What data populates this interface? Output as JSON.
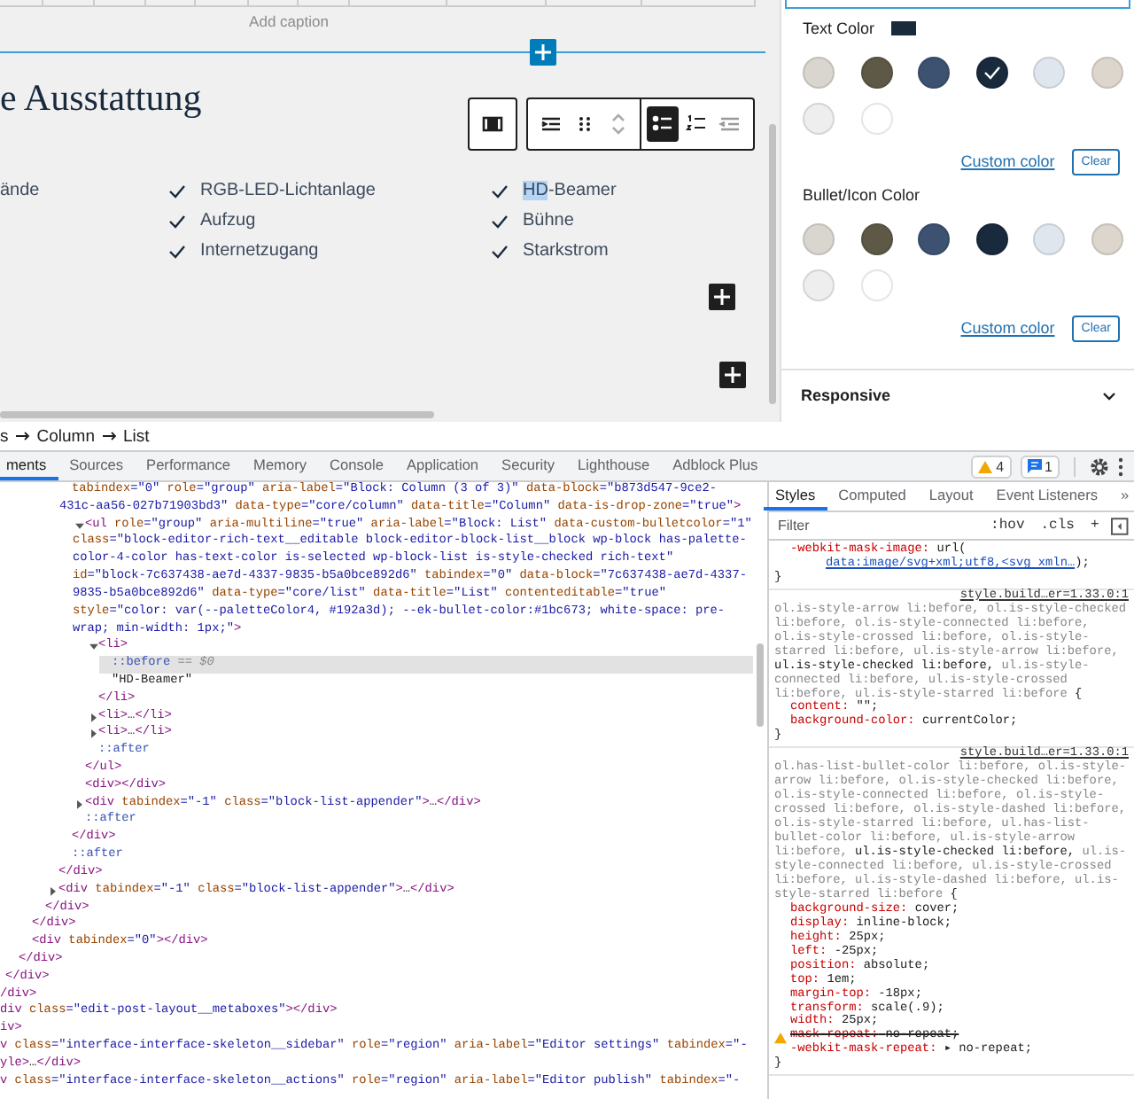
{
  "editor": {
    "caption_placeholder": "Add caption",
    "heading": "e Ausstattung",
    "toolbar": [
      {
        "buttons": [
          {
            "kind": "columns",
            "selected": false
          }
        ]
      },
      {
        "buttons": [
          {
            "kind": "indent",
            "selected": false
          },
          {
            "kind": "drag",
            "selected": false
          },
          {
            "kind": "move",
            "selected": false
          },
          {
            "kind": "bullets",
            "selected": true
          },
          {
            "kind": "numbers",
            "selected": false
          },
          {
            "kind": "outdent",
            "selected": false
          }
        ]
      }
    ],
    "list_columns": [
      {
        "items": [
          {
            "kind": "plain",
            "parts": [
              {
                "text": "ände",
                "selected": false
              }
            ]
          }
        ]
      },
      {
        "items": [
          {
            "kind": "checked",
            "parts": [
              {
                "text": "RGB-LED-Lichtanlage",
                "selected": false
              }
            ]
          },
          {
            "kind": "checked",
            "parts": [
              {
                "text": "Aufzug",
                "selected": false
              }
            ]
          },
          {
            "kind": "checked",
            "parts": [
              {
                "text": "Internetzugang",
                "selected": false
              }
            ]
          }
        ]
      },
      {
        "items": [
          {
            "kind": "checked",
            "parts": [
              {
                "text": "HD",
                "selected": true
              },
              {
                "text": "-Beamer",
                "selected": false
              }
            ]
          },
          {
            "kind": "checked",
            "parts": [
              {
                "text": "Bühne",
                "selected": false
              }
            ]
          },
          {
            "kind": "checked",
            "parts": [
              {
                "text": "Starkstrom",
                "selected": false
              }
            ]
          }
        ]
      }
    ]
  },
  "sidebar": {
    "sections": [
      {
        "title": "Text Color",
        "current_swatch": {
          "color": "#192a3d"
        },
        "swatches": [
          {
            "color": "#d9d5cf",
            "selected": false
          },
          {
            "color": "#5e5846",
            "selected": false
          },
          {
            "color": "#3d5170",
            "selected": false
          },
          {
            "color": "#192a3d",
            "selected": true
          },
          {
            "color": "#dfe6ed",
            "selected": false
          },
          {
            "color": "#dcd6cc",
            "selected": false
          },
          {
            "color": "#eeeeee",
            "selected": false
          },
          {
            "color": "#ffffff",
            "selected": false
          }
        ],
        "custom_link": "Custom color",
        "clear_button": "Clear"
      },
      {
        "title": "Bullet/Icon Color",
        "swatches": [
          {
            "color": "#d9d5cf",
            "selected": false
          },
          {
            "color": "#5e5846",
            "selected": false
          },
          {
            "color": "#3d5170",
            "selected": false
          },
          {
            "color": "#192a3d",
            "selected": false
          },
          {
            "color": "#dfe6ed",
            "selected": false
          },
          {
            "color": "#dcd6cc",
            "selected": false
          },
          {
            "color": "#eeeeee",
            "selected": false
          },
          {
            "color": "#ffffff",
            "selected": false
          }
        ],
        "custom_link": "Custom color",
        "clear_button": "Clear"
      }
    ],
    "panel": {
      "title": "Responsive",
      "expanded": false
    }
  },
  "breadcrumb": [
    "s",
    "Column",
    "List"
  ],
  "devtools": {
    "tabs": [
      {
        "label": "ments",
        "selected": true
      },
      {
        "label": "Sources",
        "selected": false
      },
      {
        "label": "Performance",
        "selected": false
      },
      {
        "label": "Memory",
        "selected": false
      },
      {
        "label": "Console",
        "selected": false
      },
      {
        "label": "Application",
        "selected": false
      },
      {
        "label": "Security",
        "selected": false
      },
      {
        "label": "Lighthouse",
        "selected": false
      },
      {
        "label": "Adblock Plus",
        "selected": false
      }
    ],
    "warnings": "4",
    "messages": "1",
    "dom_tree": [
      {
        "children": [
          {
            "children": [
              {
                "children": [
                  {
                    "children": [
                      {
                        "children": [
                          {
                            "children": [
                              {
                                "selected": false,
                                "segments": [
                                  {
                                    "kind": "attr",
                                    "text": "tabindex"
                                  },
                                  {
                                    "kind": "value",
                                    "text": "=\"0\""
                                  },
                                  {
                                    "kind": "attr",
                                    "text": " role"
                                  },
                                  {
                                    "kind": "value",
                                    "text": "=\"group\""
                                  },
                                  {
                                    "kind": "attr",
                                    "text": " aria-label"
                                  },
                                  {
                                    "kind": "value",
                                    "text": "=\"Block: Column (3 of 3)\""
                                  },
                                  {
                                    "kind": "attr",
                                    "text": " data-block"
                                  },
                                  {
                                    "kind": "value",
                                    "text": "=\"b873d547-9ce2-431c-aa56-027b71903bd3\""
                                  },
                                  {
                                    "kind": "attr",
                                    "text": " data-type"
                                  },
                                  {
                                    "kind": "value",
                                    "text": "=\"core/column\""
                                  },
                                  {
                                    "kind": "attr",
                                    "text": " data-title"
                                  },
                                  {
                                    "kind": "value",
                                    "text": "=\"Column\""
                                  },
                                  {
                                    "kind": "attr",
                                    "text": " data-is-drop-zone"
                                  },
                                  {
                                    "kind": "value",
                                    "text": "=\"true\""
                                  },
                                  {
                                    "kind": "tag",
                                    "text": ">"
                                  }
                                ],
                                "children": [
                                  {
                                    "expanded": true,
                                    "selected": false,
                                    "segments": [
                                      {
                                        "kind": "tag",
                                        "text": "<ul"
                                      },
                                      {
                                        "kind": "attr",
                                        "text": " role"
                                      },
                                      {
                                        "kind": "value",
                                        "text": "=\"group\""
                                      },
                                      {
                                        "kind": "attr",
                                        "text": " aria-multiline"
                                      },
                                      {
                                        "kind": "value",
                                        "text": "=\"true\""
                                      },
                                      {
                                        "kind": "attr",
                                        "text": " aria-label"
                                      },
                                      {
                                        "kind": "value",
                                        "text": "=\"Block: List\""
                                      },
                                      {
                                        "kind": "attr",
                                        "text": " data-custom-bulletcolor"
                                      },
                                      {
                                        "kind": "value",
                                        "text": "=\"1\""
                                      },
                                      {
                                        "kind": "attr",
                                        "text": " class"
                                      },
                                      {
                                        "kind": "value",
                                        "text": "=\"block-editor-rich-text__editable block-editor-block-list__block wp-block has-palette-color-4-color has-text-color is-selected wp-block-list is-style-checked rich-text\""
                                      },
                                      {
                                        "kind": "attr",
                                        "text": " id"
                                      },
                                      {
                                        "kind": "value",
                                        "text": "=\"block-7c637438-ae7d-4337-9835-b5a0bce892d6\""
                                      },
                                      {
                                        "kind": "attr",
                                        "text": " tabindex"
                                      },
                                      {
                                        "kind": "value",
                                        "text": "=\"0\""
                                      },
                                      {
                                        "kind": "attr",
                                        "text": " data-block"
                                      },
                                      {
                                        "kind": "value",
                                        "text": "=\"7c637438-ae7d-4337-9835-b5a0bce892d6\""
                                      },
                                      {
                                        "kind": "attr",
                                        "text": " data-type"
                                      },
                                      {
                                        "kind": "value",
                                        "text": "=\"core/list\""
                                      },
                                      {
                                        "kind": "attr",
                                        "text": " data-title"
                                      },
                                      {
                                        "kind": "value",
                                        "text": "=\"List\""
                                      },
                                      {
                                        "kind": "attr",
                                        "text": " contenteditable"
                                      },
                                      {
                                        "kind": "value",
                                        "text": "=\"true\""
                                      },
                                      {
                                        "kind": "attr",
                                        "text": " style"
                                      },
                                      {
                                        "kind": "value",
                                        "text": "=\"color: var(--paletteColor4, #192a3d); --ek-bullet-color:#1bc673; white-space: pre-wrap; min-width: 1px;\""
                                      },
                                      {
                                        "kind": "tag",
                                        "text": ">"
                                      }
                                    ],
                                    "children": [
                                      {
                                        "expanded": true,
                                        "selected": false,
                                        "segments": [
                                          {
                                            "kind": "tag",
                                            "text": "<li>"
                                          }
                                        ],
                                        "children": [
                                          {
                                            "selected": true,
                                            "segments": [
                                              {
                                                "kind": "pseudo",
                                                "text": "::before"
                                              },
                                              {
                                                "kind": "hint",
                                                "text": " == $0"
                                              }
                                            ]
                                          },
                                          {
                                            "selected": false,
                                            "segments": [
                                              {
                                                "kind": "text",
                                                "text": "\"HD-Beamer\""
                                              }
                                            ]
                                          }
                                        ]
                                      },
                                      {
                                        "selected": false,
                                        "segments": [
                                          {
                                            "kind": "tag",
                                            "text": "</li>"
                                          }
                                        ]
                                      },
                                      {
                                        "expanded": false,
                                        "selected": false,
                                        "segments": [
                                          {
                                            "kind": "tag",
                                            "text": "<li>"
                                          },
                                          {
                                            "kind": "text",
                                            "text": "…"
                                          },
                                          {
                                            "kind": "tag",
                                            "text": "</li>"
                                          }
                                        ]
                                      },
                                      {
                                        "expanded": false,
                                        "selected": false,
                                        "segments": [
                                          {
                                            "kind": "tag",
                                            "text": "<li>"
                                          },
                                          {
                                            "kind": "text",
                                            "text": "…"
                                          },
                                          {
                                            "kind": "tag",
                                            "text": "</li>"
                                          }
                                        ]
                                      },
                                      {
                                        "selected": false,
                                        "segments": [
                                          {
                                            "kind": "pseudo",
                                            "text": "::after"
                                          }
                                        ]
                                      }
                                    ]
                                  },
                                  {
                                    "selected": false,
                                    "segments": [
                                      {
                                        "kind": "tag",
                                        "text": "</ul>"
                                      }
                                    ]
                                  },
                                  {
                                    "selected": false,
                                    "segments": [
                                      {
                                        "kind": "tag",
                                        "text": "<div></div>"
                                      }
                                    ]
                                  },
                                  {
                                    "expanded": false,
                                    "selected": false,
                                    "segments": [
                                      {
                                        "kind": "tag",
                                        "text": "<div"
                                      },
                                      {
                                        "kind": "attr",
                                        "text": " tabindex"
                                      },
                                      {
                                        "kind": "value",
                                        "text": "=\"-1\""
                                      },
                                      {
                                        "kind": "attr",
                                        "text": " class"
                                      },
                                      {
                                        "kind": "value",
                                        "text": "=\"block-list-appender\""
                                      },
                                      {
                                        "kind": "tag",
                                        "text": ">"
                                      },
                                      {
                                        "kind": "text",
                                        "text": "…"
                                      },
                                      {
                                        "kind": "tag",
                                        "text": "</div>"
                                      }
                                    ]
                                  },
                                  {
                                    "selected": false,
                                    "segments": [
                                      {
                                        "kind": "pseudo",
                                        "text": "::after"
                                      }
                                    ]
                                  }
                                ]
                              },
                              {
                                "selected": false,
                                "segments": [
                                  {
                                    "kind": "tag",
                                    "text": "</div>"
                                  }
                                ]
                              },
                              {
                                "selected": false,
                                "segments": [
                                  {
                                    "kind": "pseudo",
                                    "text": "::after"
                                  }
                                ]
                              }
                            ]
                          },
                          {
                            "selected": false,
                            "segments": [
                              {
                                "kind": "tag",
                                "text": "</div>"
                              }
                            ]
                          },
                          {
                            "expanded": false,
                            "selected": false,
                            "segments": [
                              {
                                "kind": "tag",
                                "text": "<div"
                              },
                              {
                                "kind": "attr",
                                "text": " tabindex"
                              },
                              {
                                "kind": "value",
                                "text": "=\"-1\""
                              },
                              {
                                "kind": "attr",
                                "text": " class"
                              },
                              {
                                "kind": "value",
                                "text": "=\"block-list-appender\""
                              },
                              {
                                "kind": "tag",
                                "text": ">"
                              },
                              {
                                "kind": "text",
                                "text": "…"
                              },
                              {
                                "kind": "tag",
                                "text": "</div>"
                              }
                            ]
                          }
                        ]
                      },
                      {
                        "selected": false,
                        "segments": [
                          {
                            "kind": "tag",
                            "text": "</div>"
                          }
                        ]
                      }
                    ]
                  },
                  {
                    "selected": false,
                    "segments": [
                      {
                        "kind": "tag",
                        "text": "</div>"
                      }
                    ]
                  },
                  {
                    "selected": false,
                    "segments": [
                      {
                        "kind": "tag",
                        "text": "<div"
                      },
                      {
                        "kind": "attr",
                        "text": " tabindex"
                      },
                      {
                        "kind": "value",
                        "text": "=\"0\""
                      },
                      {
                        "kind": "tag",
                        "text": "></div>"
                      }
                    ]
                  }
                ]
              },
              {
                "selected": false,
                "segments": [
                  {
                    "kind": "tag",
                    "text": "</div>"
                  }
                ]
              }
            ]
          },
          {
            "selected": false,
            "segments": [
              {
                "kind": "tag",
                "text": "</div>"
              }
            ]
          }
        ]
      },
      {
        "selected": false,
        "segments": [
          {
            "kind": "tag",
            "text": "/div>"
          }
        ]
      },
      {
        "selected": false,
        "segments": [
          {
            "kind": "tag",
            "text": "div"
          },
          {
            "kind": "attr",
            "text": " class"
          },
          {
            "kind": "value",
            "text": "=\"edit-post-layout__metaboxes\""
          },
          {
            "kind": "tag",
            "text": "></div>"
          }
        ]
      },
      {
        "selected": false,
        "segments": [
          {
            "kind": "tag",
            "text": "iv>"
          }
        ]
      },
      {
        "selected": false,
        "segments": [
          {
            "kind": "tag",
            "text": "v"
          },
          {
            "kind": "attr",
            "text": " class"
          },
          {
            "kind": "value",
            "text": "=\"interface-interface-skeleton__sidebar\""
          },
          {
            "kind": "attr",
            "text": " role"
          },
          {
            "kind": "value",
            "text": "=\"region\""
          },
          {
            "kind": "attr",
            "text": " aria-label"
          },
          {
            "kind": "value",
            "text": "=\"Editor settings\""
          },
          {
            "kind": "attr",
            "text": " tabindex"
          },
          {
            "kind": "value",
            "text": "=\"-"
          }
        ]
      },
      {
        "selected": false,
        "segments": [
          {
            "kind": "tag",
            "text": "yle>"
          },
          {
            "kind": "text",
            "text": "…"
          },
          {
            "kind": "tag",
            "text": "</div>"
          }
        ]
      },
      {
        "selected": false,
        "segments": [
          {
            "kind": "tag",
            "text": "v"
          },
          {
            "kind": "attr",
            "text": " class"
          },
          {
            "kind": "value",
            "text": "=\"interface-interface-skeleton__actions\""
          },
          {
            "kind": "attr",
            "text": " role"
          },
          {
            "kind": "value",
            "text": "=\"region\""
          },
          {
            "kind": "attr",
            "text": " aria-label"
          },
          {
            "kind": "value",
            "text": "=\"Editor publish\""
          },
          {
            "kind": "attr",
            "text": " tabindex"
          },
          {
            "kind": "value",
            "text": "=\"-"
          }
        ]
      }
    ],
    "styles": {
      "tabs": [
        {
          "label": "Styles",
          "selected": true
        },
        {
          "label": "Computed",
          "selected": false
        },
        {
          "label": "Layout",
          "selected": false
        },
        {
          "label": "Event Listeners",
          "selected": false
        }
      ],
      "more": "»",
      "filter_placeholder": "Filter",
      "hov": ":hov",
      "cls": ".cls",
      "add": "+",
      "rules": [
        {
          "properties": [
            {
              "name": "-webkit-mask-image:",
              "value": "url(",
              "link": "data:image/svg+xml;utf8,<svg xmln…",
              "after": ");",
              "overridden": false,
              "warning": false
            }
          ],
          "brace_close": "}"
        },
        {
          "source": "style.build…er=1.33.0:1",
          "selectors": [
            {
              "text": "ol.is-style-arrow li:before, ol.is-style-checked li:before, ol.is-style-connected li:before, ol.is-style-crossed li:before, ol.is-style-starred li:before, ul.is-style-arrow li:before, ",
              "matched": false
            },
            {
              "text": "ul.is-style-checked li:before,",
              "matched": true
            },
            {
              "text": " ul.is-style-connected li:before, ul.is-style-crossed li:before, ul.is-style-starred li:before",
              "matched": false
            }
          ],
          "brace_open": " {",
          "properties": [
            {
              "name": "content:",
              "value": "\"\";",
              "overridden": false,
              "warning": false
            },
            {
              "name": "background-color:",
              "value": "currentColor;",
              "overridden": false,
              "warning": false
            }
          ],
          "brace_close": "}"
        },
        {
          "source": "style.build…er=1.33.0:1",
          "selectors": [
            {
              "text": "ol.has-list-bullet-color li:before, ol.is-style-arrow li:before, ol.is-style-checked li:before, ol.is-style-connected li:before, ol.is-style-crossed li:before, ol.is-style-dashed li:before, ol.is-style-starred li:before, ul.has-list-bullet-color li:before, ul.is-style-arrow li:before, ",
              "matched": false
            },
            {
              "text": "ul.is-style-checked li:before,",
              "matched": true
            },
            {
              "text": " ul.is-style-connected li:before, ul.is-style-crossed li:before, ul.is-style-dashed li:before, ul.is-style-starred li:before",
              "matched": false
            }
          ],
          "brace_open": " {",
          "properties": [
            {
              "name": "background-size:",
              "value": "cover;",
              "overridden": false,
              "warning": false
            },
            {
              "name": "display:",
              "value": "inline-block;",
              "overridden": false,
              "warning": false
            },
            {
              "name": "height:",
              "value": "25px;",
              "overridden": false,
              "warning": false
            },
            {
              "name": "left:",
              "value": "-25px;",
              "overridden": false,
              "warning": false
            },
            {
              "name": "position:",
              "value": "absolute;",
              "overridden": false,
              "warning": false
            },
            {
              "name": "top:",
              "value": "1em;",
              "overridden": false,
              "warning": false
            },
            {
              "name": "margin-top:",
              "value": "-18px;",
              "overridden": false,
              "warning": false
            },
            {
              "name": "transform:",
              "value": "scale(.9);",
              "overridden": false,
              "warning": false
            },
            {
              "name": "width:",
              "value": "25px;",
              "overridden": false,
              "warning": false
            },
            {
              "name": "mask-repeat:",
              "value": "no-repeat;",
              "overridden": true,
              "warning": true
            },
            {
              "name": "-webkit-mask-repeat:",
              "value": "▸ no-repeat;",
              "overridden": false,
              "warning": false
            }
          ],
          "brace_close": "}"
        }
      ]
    }
  }
}
